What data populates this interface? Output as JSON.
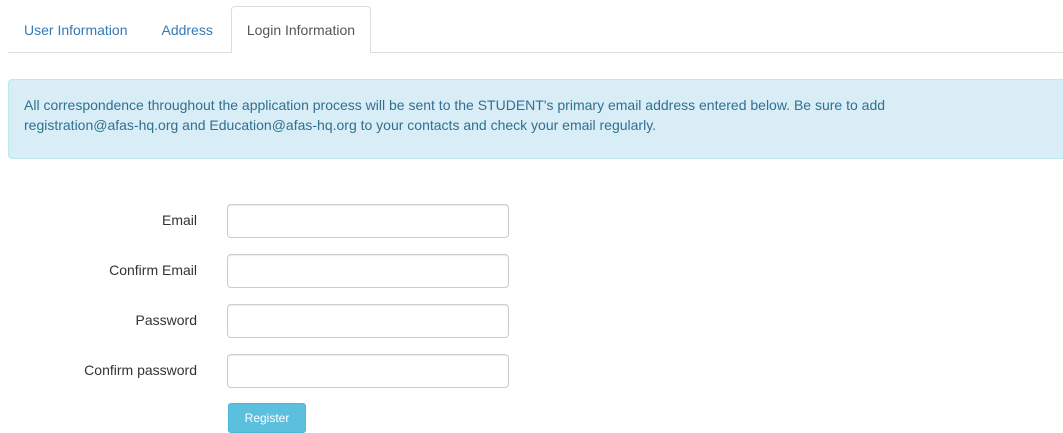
{
  "tabs": [
    {
      "label": "User Information",
      "active": false
    },
    {
      "label": "Address",
      "active": false
    },
    {
      "label": "Login Information",
      "active": true
    }
  ],
  "notice": {
    "line1": "All correspondence throughout the application process will be sent to the STUDENT's primary email address entered below. Be sure to add",
    "line2": "registration@afas-hq.org and Education@afas-hq.org to your contacts and check your email regularly."
  },
  "form": {
    "email": {
      "label": "Email",
      "value": "",
      "placeholder": ""
    },
    "confirm_email": {
      "label": "Confirm Email",
      "value": "",
      "placeholder": ""
    },
    "password": {
      "label": "Password",
      "value": "",
      "placeholder": ""
    },
    "confirm_password": {
      "label": "Confirm password",
      "value": "",
      "placeholder": ""
    },
    "register_label": "Register"
  },
  "colors": {
    "link": "#337ab7",
    "alert_bg": "#d9edf7",
    "alert_text": "#31708f",
    "button_bg": "#5bc0de"
  }
}
